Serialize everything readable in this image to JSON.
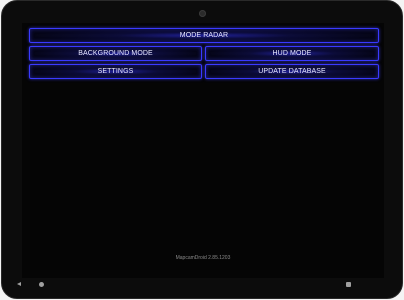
{
  "buttons": {
    "mode_radar": "MODE RADAR",
    "background_mode": "BACKGROUND MODE",
    "hud_mode": "HUD MODE",
    "settings": "SETTINGS",
    "update_database": "UPDATE DATABASE"
  },
  "footer": {
    "version": "MapcamDroid 2.85.1203"
  },
  "navbar": {
    "back_icon": "triangle-left",
    "home_icon": "circle",
    "recent_icon": "square"
  },
  "colors": {
    "button_border": "#3a3aff",
    "button_glow": "#2828c8",
    "background": "#050505"
  }
}
